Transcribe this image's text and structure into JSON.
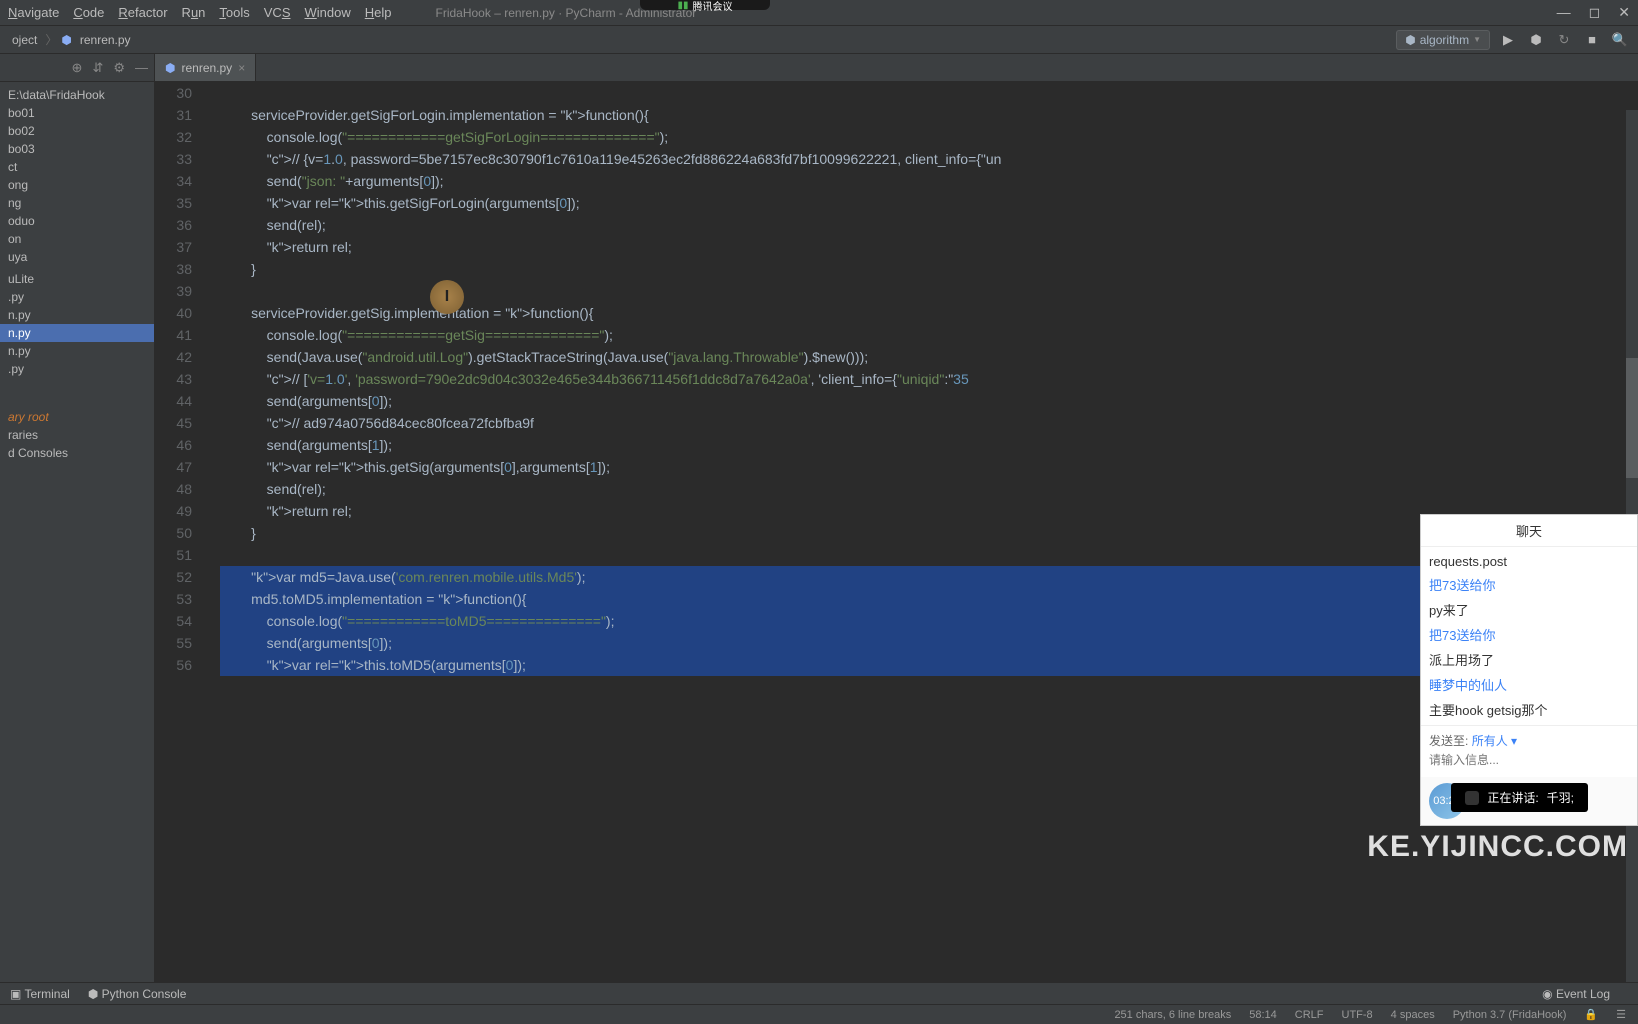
{
  "overlay": {
    "app": "腾讯会议"
  },
  "menu": [
    "Navigate",
    "Code",
    "Refactor",
    "Run",
    "Tools",
    "VCS",
    "Window",
    "Help"
  ],
  "window_title": "FridaHook – renren.py · PyCharm - Administrator",
  "breadcrumb": {
    "project": "oject",
    "file": "renren.py"
  },
  "run_config": "algorithm",
  "sidebar": {
    "root": "E:\\data\\FridaHook",
    "items": [
      "bo01",
      "bo02",
      "bo03",
      "ct",
      "ong",
      "ng",
      "oduo",
      "on",
      "uya",
      "",
      "uLite",
      ".py",
      "n.py",
      "n.py",
      "n.py",
      ".py"
    ],
    "active_index": 13,
    "lib_root": "ary root",
    "scratches": [
      "raries",
      "d Consoles"
    ]
  },
  "tab": {
    "name": "renren.py"
  },
  "gutter_start": 30,
  "code_lines": [
    "",
    "        serviceProvider.getSigForLogin.implementation = function(){",
    "            console.log(\"============getSigForLogin==============\");",
    "            // {v=1.0, password=5be7157ec8c30790f1c7610a119e45263ec2fd886224a683fd7bf10099622221, client_info={\"un",
    "            send(\"json: \"+arguments[0]);",
    "            var rel=this.getSigForLogin(arguments[0]);",
    "            send(rel);",
    "            return rel;",
    "        }",
    "",
    "        serviceProvider.getSig.implementation = function(){",
    "            console.log(\"============getSig==============\");",
    "            send(Java.use(\"android.util.Log\").getStackTraceString(Java.use(\"java.lang.Throwable\").$new()));",
    "            // ['v=1.0', 'password=790e2dc9d04c3032e465e344b366711456f1ddc8d7a7642a0a', 'client_info={\"uniqid\":\"35",
    "            send(arguments[0]);",
    "            // ad974a0756d84cec80fcea72fcbfba9f",
    "            send(arguments[1]);",
    "            var rel=this.getSig(arguments[0],arguments[1]);",
    "            send(rel);",
    "            return rel;",
    "        }",
    "",
    "        var md5=Java.use('com.renren.mobile.utils.Md5');",
    "        md5.toMD5.implementation = function(){",
    "            console.log(\"============toMD5==============\");",
    "            send(arguments[0]);",
    "            var rel=this.toMD5(arguments[0]);"
  ],
  "selected_from": 22,
  "bottom": {
    "terminal": "Terminal",
    "pyconsole": "Python Console",
    "eventlog": "Event Log"
  },
  "status": {
    "chars": "251 chars, 6 line breaks",
    "pos": "58:14",
    "crlf": "CRLF",
    "encoding": "UTF-8",
    "indent": "4 spaces",
    "interpreter": "Python 3.7 (FridaHook)"
  },
  "chat": {
    "title": "聊天",
    "messages": [
      {
        "text": "requests.post",
        "blue": false
      },
      {
        "text": "把73送给你",
        "blue": true
      },
      {
        "text": "py来了",
        "blue": false
      },
      {
        "text": "把73送给你",
        "blue": true
      },
      {
        "text": "派上用场了",
        "blue": false
      },
      {
        "text": "睡梦中的仙人",
        "blue": true
      },
      {
        "text": "主要hook getsig那个",
        "blue": false
      }
    ],
    "sendto_label": "发送至:",
    "sendto_target": "所有人 ▾",
    "placeholder": "请输入信息...",
    "timer": "03:25"
  },
  "speaking": {
    "label": "正在讲话:",
    "name": "千羽;"
  },
  "watermark": "KE.YIJINCC.COM"
}
